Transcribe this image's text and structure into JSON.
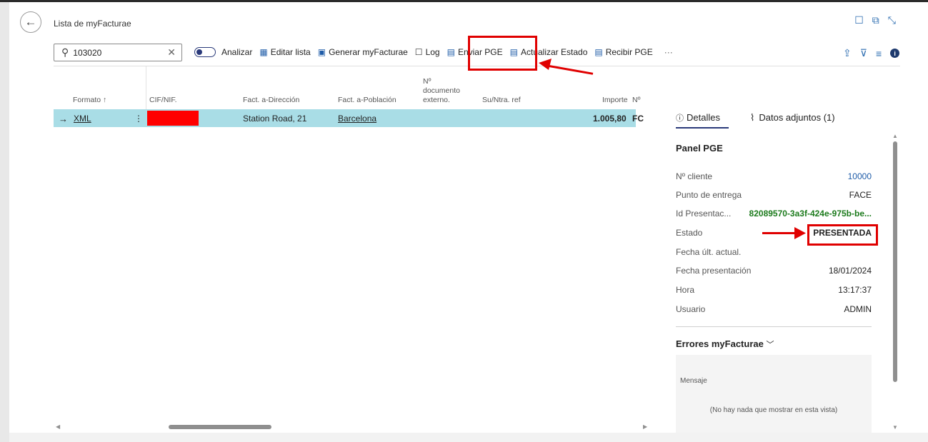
{
  "page": {
    "title": "Lista de myFacturae"
  },
  "search": {
    "value": "103020"
  },
  "toolbar": {
    "analizar": "Analizar",
    "editar_lista": "Editar lista",
    "generar": "Generar myFacturae",
    "log": "Log",
    "enviar": "Enviar PGE",
    "actualizar": "Actualizar Estado",
    "recibir": "Recibir PGE",
    "more": "···"
  },
  "table": {
    "headers": [
      "Formato ↑",
      "CIF/NIF.",
      "Fact. a-Dirección",
      "Fact. a-Población",
      "Nº documento externo.",
      "Su/Ntra. ref",
      "Importe",
      "Nº"
    ],
    "row": {
      "formato": "XML",
      "direccion": "Station Road, 21",
      "poblacion": "Barcelona",
      "importe": "1.005,80",
      "no_partial": "FC"
    }
  },
  "panel": {
    "tabs": {
      "detalles": "Detalles",
      "adjuntos": "Datos adjuntos (1)"
    },
    "title": "Panel PGE",
    "fields": [
      {
        "label": "Nº cliente",
        "value": "10000"
      },
      {
        "label": "Punto de entrega",
        "value": "FACE"
      },
      {
        "label": "Id Presentac...",
        "value": "82089570-3a3f-424e-975b-be..."
      },
      {
        "label": "Estado",
        "value": "PRESENTADA"
      },
      {
        "label": "Fecha últ. actual.",
        "value": ""
      },
      {
        "label": "Fecha presentación",
        "value": "18/01/2024"
      },
      {
        "label": "Hora",
        "value": "13:17:37"
      },
      {
        "label": "Usuario",
        "value": "ADMIN"
      }
    ],
    "errors": {
      "title": "Errores myFacturae",
      "column": "Mensaje",
      "empty": "(No hay nada que mostrar en esta vista)"
    }
  },
  "colors": {
    "selected_row": "#a9dde6",
    "annotation": "#e00000",
    "link_blue": "#1f5ca8",
    "id_green": "#1b7a1b"
  }
}
